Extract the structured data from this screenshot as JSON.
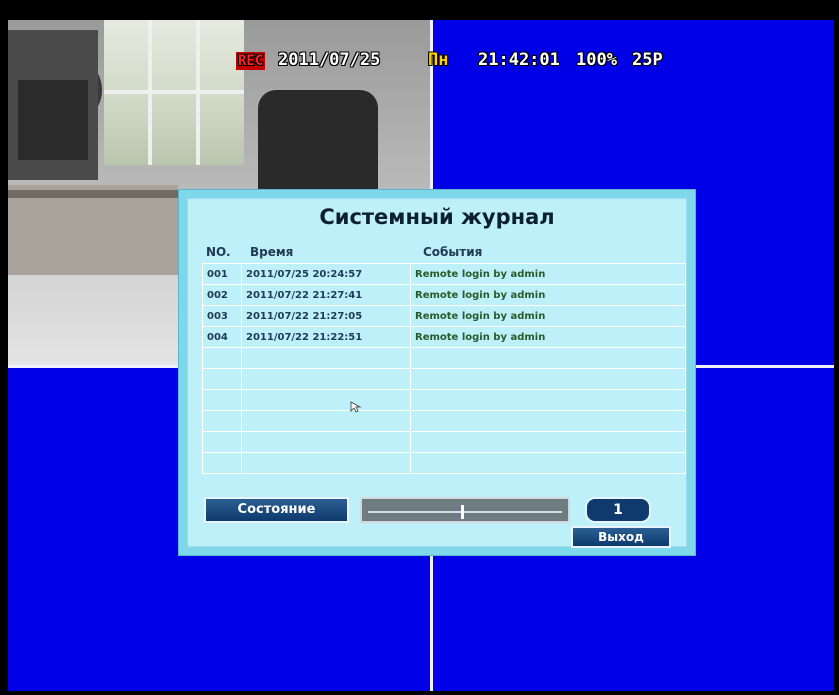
{
  "osd": {
    "rec": "REC",
    "date": "2011/07/25",
    "weekday": "Пн",
    "time": "21:42:01",
    "quality": "100%",
    "framerate": "25P"
  },
  "dialog": {
    "title": "Системный журнал",
    "columns": {
      "no": "NO.",
      "time": "Время",
      "event": "События"
    },
    "rows": [
      {
        "no": "001",
        "time": "2011/07/25 20:24:57",
        "event": "Remote login by admin"
      },
      {
        "no": "002",
        "time": "2011/07/22 21:27:41",
        "event": "Remote login by admin"
      },
      {
        "no": "003",
        "time": "2011/07/22 21:27:05",
        "event": "Remote login by admin"
      },
      {
        "no": "004",
        "time": "2011/07/22 21:22:51",
        "event": "Remote login by admin"
      },
      {
        "no": "",
        "time": "",
        "event": ""
      },
      {
        "no": "",
        "time": "",
        "event": ""
      },
      {
        "no": "",
        "time": "",
        "event": ""
      },
      {
        "no": "",
        "time": "",
        "event": ""
      },
      {
        "no": "",
        "time": "",
        "event": ""
      },
      {
        "no": "",
        "time": "",
        "event": ""
      }
    ],
    "status_button": "Состояние",
    "page": "1",
    "exit_button": "Выход"
  },
  "colors": {
    "screen_background": "#0000e6",
    "dialog_background": "#bdf0f8",
    "button_background": "#0e3a6e"
  }
}
